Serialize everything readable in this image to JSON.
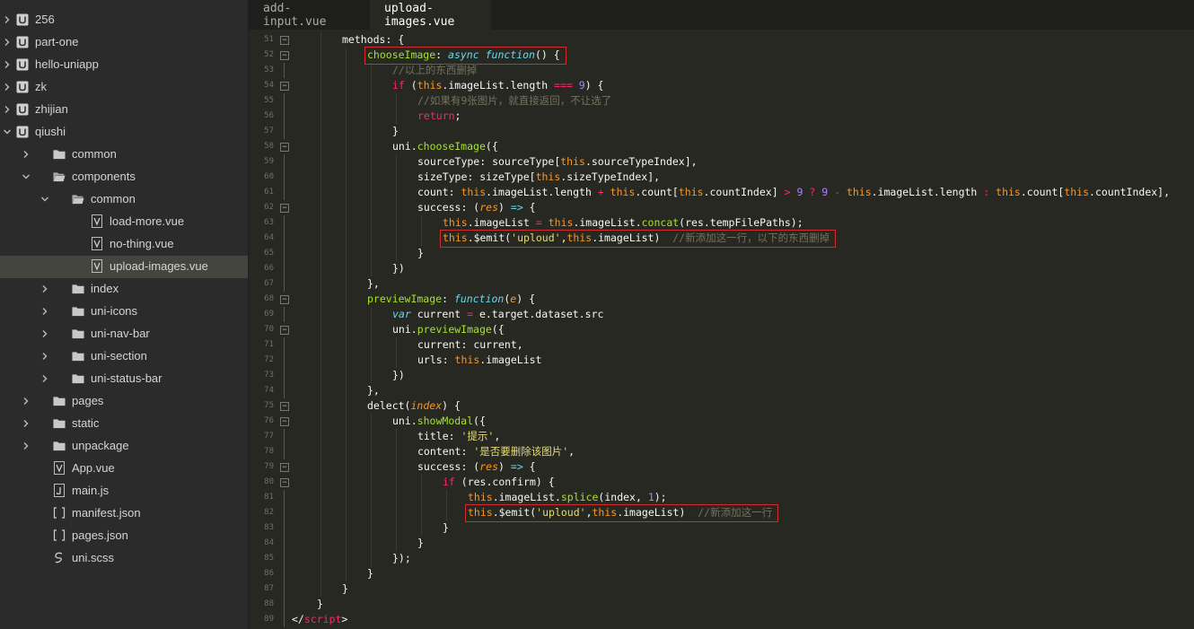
{
  "sidebar": {
    "items": [
      {
        "label": "256",
        "depth": 0,
        "kind": "project",
        "expanded": false
      },
      {
        "label": "part-one",
        "depth": 0,
        "kind": "project",
        "expanded": false
      },
      {
        "label": "hello-uniapp",
        "depth": 0,
        "kind": "project",
        "expanded": false
      },
      {
        "label": "zk",
        "depth": 0,
        "kind": "project",
        "expanded": false
      },
      {
        "label": "zhijian",
        "depth": 0,
        "kind": "project",
        "expanded": false
      },
      {
        "label": "qiushi",
        "depth": 0,
        "kind": "project",
        "expanded": true
      },
      {
        "label": "common",
        "depth": 1,
        "kind": "folder",
        "expanded": false
      },
      {
        "label": "components",
        "depth": 1,
        "kind": "folder",
        "expanded": true
      },
      {
        "label": "common",
        "depth": 2,
        "kind": "folder",
        "expanded": true
      },
      {
        "label": "load-more.vue",
        "depth": 3,
        "kind": "vue"
      },
      {
        "label": "no-thing.vue",
        "depth": 3,
        "kind": "vue"
      },
      {
        "label": "upload-images.vue",
        "depth": 3,
        "kind": "vue",
        "selected": true
      },
      {
        "label": "index",
        "depth": 2,
        "kind": "folder",
        "expanded": false
      },
      {
        "label": "uni-icons",
        "depth": 2,
        "kind": "folder",
        "expanded": false
      },
      {
        "label": "uni-nav-bar",
        "depth": 2,
        "kind": "folder",
        "expanded": false
      },
      {
        "label": "uni-section",
        "depth": 2,
        "kind": "folder",
        "expanded": false
      },
      {
        "label": "uni-status-bar",
        "depth": 2,
        "kind": "folder",
        "expanded": false
      },
      {
        "label": "pages",
        "depth": 1,
        "kind": "folder",
        "expanded": false
      },
      {
        "label": "static",
        "depth": 1,
        "kind": "folder",
        "expanded": false
      },
      {
        "label": "unpackage",
        "depth": 1,
        "kind": "folder",
        "expanded": false
      },
      {
        "label": "App.vue",
        "depth": 1,
        "kind": "vue"
      },
      {
        "label": "main.js",
        "depth": 1,
        "kind": "js"
      },
      {
        "label": "manifest.json",
        "depth": 1,
        "kind": "json"
      },
      {
        "label": "pages.json",
        "depth": 1,
        "kind": "json"
      },
      {
        "label": "uni.scss",
        "depth": 1,
        "kind": "scss"
      }
    ]
  },
  "tabs": [
    {
      "label": "add-input.vue",
      "active": false
    },
    {
      "label": "upload-images.vue",
      "active": true
    }
  ],
  "code": {
    "lines": [
      {
        "no": "51",
        "indent": 2,
        "fold": true,
        "tokens": [
          [
            "methods: {",
            "p0"
          ]
        ]
      },
      {
        "no": "52",
        "indent": 3,
        "fold": true,
        "tokens": [
          [
            "chooseImage",
            "f"
          ],
          [
            ": ",
            ""
          ],
          [
            "async",
            "kw"
          ],
          [
            " ",
            ""
          ],
          [
            "function",
            "kw"
          ],
          [
            "() {",
            ""
          ]
        ]
      },
      {
        "no": "53",
        "indent": 4,
        "fold": false,
        "tokens": [
          [
            "//以上的东西删掉",
            "c"
          ]
        ]
      },
      {
        "no": "54",
        "indent": 4,
        "fold": true,
        "tokens": [
          [
            "if",
            "k"
          ],
          [
            " (",
            ""
          ],
          [
            "this",
            "t"
          ],
          [
            ".imageList.length ",
            ""
          ],
          [
            "===",
            "k"
          ],
          [
            " ",
            ""
          ],
          [
            "9",
            "n"
          ],
          [
            ") {",
            ""
          ]
        ]
      },
      {
        "no": "55",
        "indent": 5,
        "fold": false,
        "tokens": [
          [
            "//如果有9张图片，就直接返回，不让选了",
            "c"
          ]
        ]
      },
      {
        "no": "56",
        "indent": 5,
        "fold": false,
        "tokens": [
          [
            "return",
            "k"
          ],
          [
            ";",
            ""
          ]
        ]
      },
      {
        "no": "57",
        "indent": 4,
        "fold": false,
        "tokens": [
          [
            "}",
            ""
          ]
        ]
      },
      {
        "no": "58",
        "indent": 4,
        "fold": true,
        "tokens": [
          [
            "uni",
            ""
          ],
          [
            ".",
            ""
          ],
          [
            "chooseImage",
            "f"
          ],
          [
            "({",
            ""
          ]
        ]
      },
      {
        "no": "59",
        "indent": 5,
        "fold": false,
        "tokens": [
          [
            "sourceType: sourceType[",
            ""
          ],
          [
            "this",
            "t"
          ],
          [
            ".sourceTypeIndex],",
            ""
          ]
        ]
      },
      {
        "no": "60",
        "indent": 5,
        "fold": false,
        "tokens": [
          [
            "sizeType: sizeType[",
            ""
          ],
          [
            "this",
            "t"
          ],
          [
            ".sizeTypeIndex],",
            ""
          ]
        ]
      },
      {
        "no": "61",
        "indent": 5,
        "fold": false,
        "tokens": [
          [
            "count: ",
            ""
          ],
          [
            "this",
            "t"
          ],
          [
            ".imageList.length ",
            ""
          ],
          [
            "+",
            "k"
          ],
          [
            " ",
            ""
          ],
          [
            "this",
            "t"
          ],
          [
            ".count[",
            ""
          ],
          [
            "this",
            "t"
          ],
          [
            ".countIndex] ",
            ""
          ],
          [
            ">",
            "k"
          ],
          [
            " ",
            ""
          ],
          [
            "9",
            "n"
          ],
          [
            " ",
            ""
          ],
          [
            "?",
            "k"
          ],
          [
            " ",
            ""
          ],
          [
            "9",
            "n"
          ],
          [
            " ",
            ""
          ],
          [
            "-",
            "k"
          ],
          [
            " ",
            ""
          ],
          [
            "this",
            "t"
          ],
          [
            ".imageList.length ",
            ""
          ],
          [
            ":",
            "k"
          ],
          [
            " ",
            ""
          ],
          [
            "this",
            "t"
          ],
          [
            ".count[",
            ""
          ],
          [
            "this",
            "t"
          ],
          [
            ".countIndex],",
            ""
          ]
        ]
      },
      {
        "no": "62",
        "indent": 5,
        "fold": true,
        "tokens": [
          [
            "success: (",
            ""
          ],
          [
            "res",
            "p"
          ],
          [
            ") ",
            ""
          ],
          [
            "=>",
            "kw"
          ],
          [
            " {",
            ""
          ]
        ]
      },
      {
        "no": "63",
        "indent": 6,
        "fold": false,
        "tokens": [
          [
            "this",
            "t"
          ],
          [
            ".imageList ",
            ""
          ],
          [
            "=",
            "k"
          ],
          [
            " ",
            ""
          ],
          [
            "this",
            "t"
          ],
          [
            ".imageList.",
            ""
          ],
          [
            "concat",
            "f"
          ],
          [
            "(res.tempFilePaths);",
            ""
          ]
        ]
      },
      {
        "no": "64",
        "indent": 6,
        "fold": false,
        "tokens": [
          [
            "this",
            "t"
          ],
          [
            ".$emit(",
            ""
          ],
          [
            "'uploud'",
            "s"
          ],
          [
            ",",
            ""
          ],
          [
            "this",
            "t"
          ],
          [
            ".imageList)  ",
            ""
          ],
          [
            "//新添加这一行，以下的东西删掉",
            "c"
          ]
        ]
      },
      {
        "no": "65",
        "indent": 5,
        "fold": false,
        "tokens": [
          [
            "}",
            ""
          ]
        ]
      },
      {
        "no": "66",
        "indent": 4,
        "fold": false,
        "tokens": [
          [
            "})",
            ""
          ]
        ]
      },
      {
        "no": "67",
        "indent": 3,
        "fold": false,
        "tokens": [
          [
            "},",
            ""
          ]
        ]
      },
      {
        "no": "68",
        "indent": 3,
        "fold": true,
        "tokens": [
          [
            "previewImage",
            "f"
          ],
          [
            ": ",
            ""
          ],
          [
            "function",
            "kw"
          ],
          [
            "(",
            ""
          ],
          [
            "e",
            "p"
          ],
          [
            ") {",
            ""
          ]
        ]
      },
      {
        "no": "69",
        "indent": 4,
        "fold": false,
        "tokens": [
          [
            "var",
            "kw"
          ],
          [
            " current ",
            ""
          ],
          [
            "=",
            "k"
          ],
          [
            " e.target.dataset.src",
            ""
          ]
        ]
      },
      {
        "no": "70",
        "indent": 4,
        "fold": true,
        "tokens": [
          [
            "uni.",
            ""
          ],
          [
            "previewImage",
            "f"
          ],
          [
            "({",
            ""
          ]
        ]
      },
      {
        "no": "71",
        "indent": 5,
        "fold": false,
        "tokens": [
          [
            "current",
            ""
          ],
          [
            ": current,",
            ""
          ]
        ]
      },
      {
        "no": "72",
        "indent": 5,
        "fold": false,
        "tokens": [
          [
            "urls: ",
            ""
          ],
          [
            "this",
            "t"
          ],
          [
            ".imageList",
            ""
          ]
        ]
      },
      {
        "no": "73",
        "indent": 4,
        "fold": false,
        "tokens": [
          [
            "})",
            ""
          ]
        ]
      },
      {
        "no": "74",
        "indent": 3,
        "fold": false,
        "tokens": [
          [
            "},",
            ""
          ]
        ]
      },
      {
        "no": "75",
        "indent": 3,
        "fold": true,
        "tokens": [
          [
            "delect(",
            ""
          ],
          [
            "index",
            "p"
          ],
          [
            ") {",
            ""
          ]
        ]
      },
      {
        "no": "76",
        "indent": 4,
        "fold": true,
        "tokens": [
          [
            "uni.",
            ""
          ],
          [
            "showModal",
            "f"
          ],
          [
            "({",
            ""
          ]
        ]
      },
      {
        "no": "77",
        "indent": 5,
        "fold": false,
        "tokens": [
          [
            "title: ",
            ""
          ],
          [
            "'提示'",
            "s"
          ],
          [
            ",",
            ""
          ]
        ]
      },
      {
        "no": "78",
        "indent": 5,
        "fold": false,
        "tokens": [
          [
            "content: ",
            ""
          ],
          [
            "'是否要删除该图片'",
            "s"
          ],
          [
            ",",
            ""
          ]
        ]
      },
      {
        "no": "79",
        "indent": 5,
        "fold": true,
        "tokens": [
          [
            "success: (",
            ""
          ],
          [
            "res",
            "p"
          ],
          [
            ") ",
            ""
          ],
          [
            "=>",
            "kw"
          ],
          [
            " {",
            ""
          ]
        ]
      },
      {
        "no": "80",
        "indent": 6,
        "fold": true,
        "tokens": [
          [
            "if",
            "k"
          ],
          [
            " (res.confirm) {",
            ""
          ]
        ]
      },
      {
        "no": "81",
        "indent": 7,
        "fold": false,
        "tokens": [
          [
            "this",
            "t"
          ],
          [
            ".imageList.",
            ""
          ],
          [
            "splice",
            "f"
          ],
          [
            "(index, ",
            ""
          ],
          [
            "1",
            "n"
          ],
          [
            ");",
            ""
          ]
        ]
      },
      {
        "no": "82",
        "indent": 7,
        "fold": false,
        "tokens": [
          [
            "this",
            "t"
          ],
          [
            ".$emit(",
            ""
          ],
          [
            "'uploud'",
            "s"
          ],
          [
            ",",
            ""
          ],
          [
            "this",
            "t"
          ],
          [
            ".imageList)  ",
            ""
          ],
          [
            "//新添加这一行",
            "c"
          ]
        ]
      },
      {
        "no": "83",
        "indent": 6,
        "fold": false,
        "tokens": [
          [
            "}",
            ""
          ]
        ]
      },
      {
        "no": "84",
        "indent": 5,
        "fold": false,
        "tokens": [
          [
            "}",
            ""
          ]
        ]
      },
      {
        "no": "85",
        "indent": 4,
        "fold": false,
        "tokens": [
          [
            "});",
            ""
          ]
        ]
      },
      {
        "no": "86",
        "indent": 3,
        "fold": false,
        "tokens": [
          [
            "}",
            ""
          ]
        ]
      },
      {
        "no": "87",
        "indent": 2,
        "fold": false,
        "tokens": [
          [
            "}",
            ""
          ]
        ]
      },
      {
        "no": "88",
        "indent": 1,
        "fold": false,
        "tokens": [
          [
            "}",
            ""
          ]
        ]
      },
      {
        "no": "89",
        "indent": 0,
        "fold": false,
        "tokens": [
          [
            "</",
            ""
          ],
          [
            "script",
            "k"
          ],
          [
            ">",
            ""
          ]
        ]
      }
    ]
  },
  "highlights": [
    "52",
    "64",
    "82"
  ],
  "colors": {
    "background": "#272822",
    "sidebar": "#2b2b2b",
    "highlight_border": "#d22c2c",
    "keyword": "#f92672",
    "function": "#a6e22e",
    "string": "#e6db74",
    "comment": "#75715e",
    "this": "#fd971f"
  }
}
